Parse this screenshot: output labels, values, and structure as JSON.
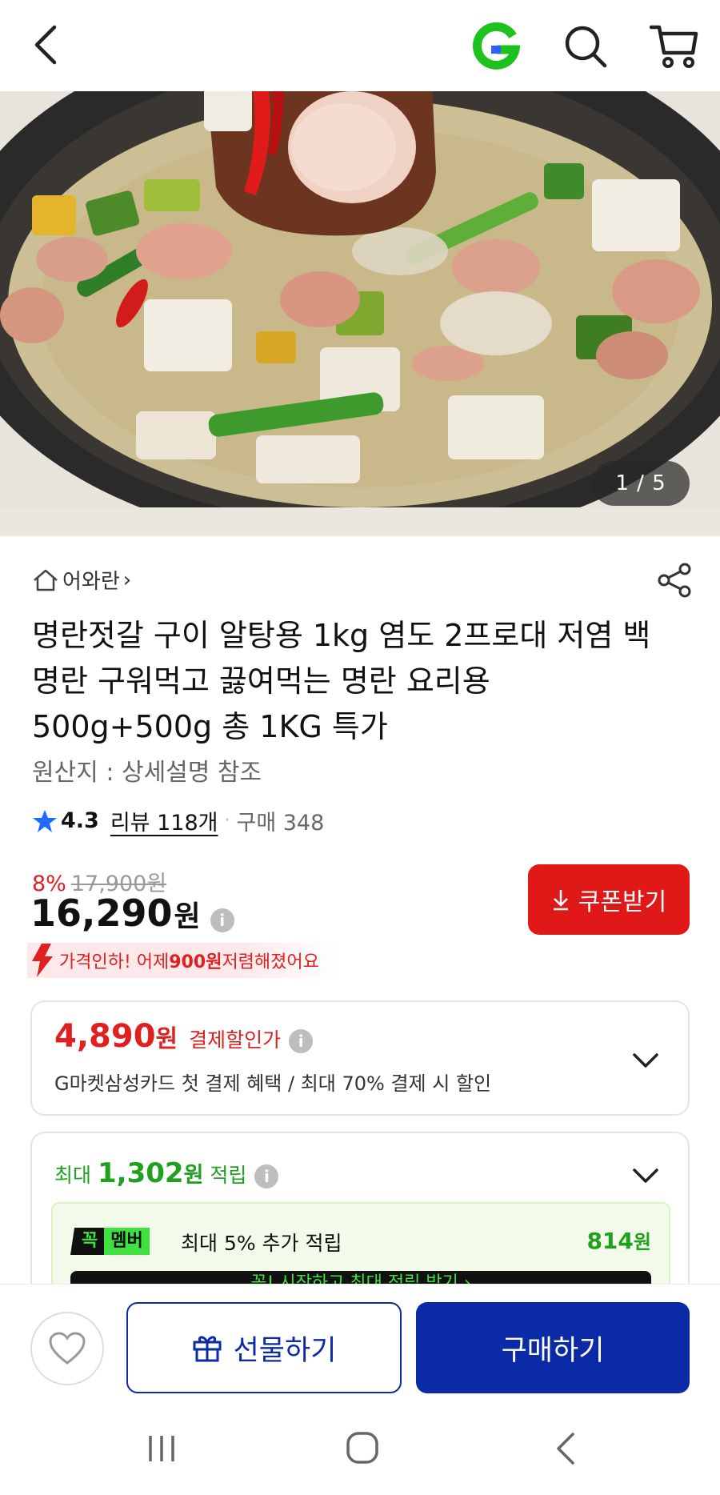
{
  "topbar": {
    "back_icon": "chevron-left-icon",
    "logo_letter": "G",
    "search_icon": "search-icon",
    "cart_icon": "cart-icon"
  },
  "hero": {
    "counter": "1 / 5"
  },
  "product": {
    "store_name": "어와란",
    "store_chevron": "›",
    "title": "명란젓갈 구이 알탕용 1kg 염도 2프로대 저염 백명란 구워먹고 끓여먹는 명란 요리용 500g+500g 총 1KG 특가",
    "origin": "원산지 : 상세설명 참조",
    "rating": "4.3",
    "review_text": "리뷰 118개",
    "purchase_text": "구매 348",
    "discount_pct": "8%",
    "original_price": "17,900원",
    "price": "16,290",
    "price_unit": "원",
    "coupon_button": "쿠폰받기",
    "price_drop_prefix": "가격인하! 어제 ",
    "price_drop_amount": "900원",
    "price_drop_suffix": " 저렴해졌어요"
  },
  "payment": {
    "amount": "4,890",
    "unit": "원",
    "label": "결제할인가",
    "description": "G마켓삼성카드 첫 결제 혜택 / 최대 70% 결제 시 할인"
  },
  "reward": {
    "prefix": "최대",
    "amount": "1,302",
    "unit": "원",
    "suffix": "적립",
    "member_badge_1": "꼭",
    "member_badge_2": "멤버",
    "member_text": "최대 5% 추가 적립",
    "member_amount": "814",
    "member_unit": "원",
    "join_text": "꼭! 시작하고 최대 적립 받기 ›"
  },
  "actions": {
    "gift_label": "선물하기",
    "buy_label": "구매하기"
  },
  "colors": {
    "brand_blue": "#0a2aa6",
    "sale_red": "#e02020",
    "reward_green": "#1fa01f",
    "logo_green": "#1ec21e"
  }
}
